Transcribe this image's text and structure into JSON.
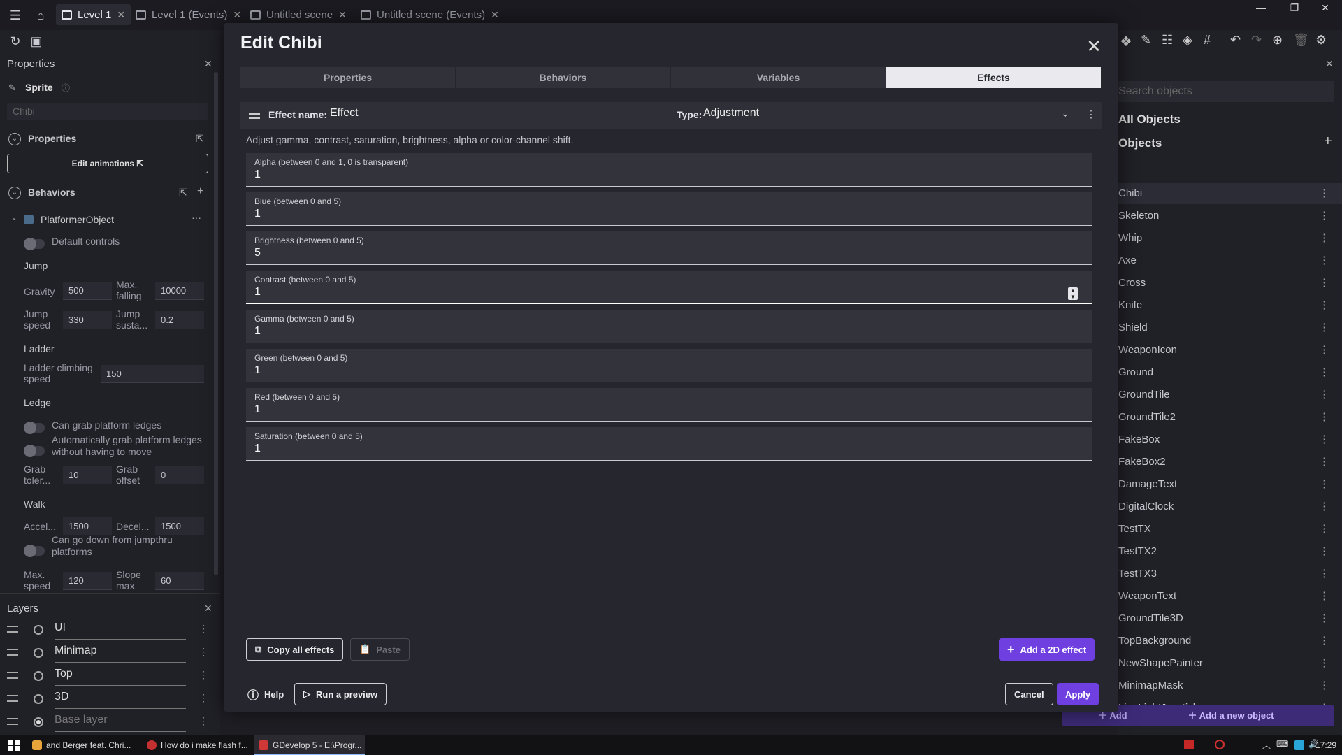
{
  "topbar": {
    "tabs": [
      {
        "label": "Level 1"
      },
      {
        "label": "Level 1 (Events)"
      },
      {
        "label": "Untitled scene"
      },
      {
        "label": "Untitled scene (Events)"
      }
    ],
    "clock": "17:29"
  },
  "left": {
    "properties_title": "Properties",
    "object_type": "Sprite",
    "object_name_placeholder": "Chibi",
    "properties_section": "Properties",
    "edit_animations": "Edit animations",
    "behaviors_section": "Behaviors",
    "behavior_name": "PlatformerObject",
    "default_controls": "Default controls",
    "jump_group": "Jump",
    "gravity_label": "Gravity",
    "gravity_value": "500",
    "max_falling_label": "Max. falling",
    "max_falling_value": "10000",
    "jump_speed_label": "Jump speed",
    "jump_speed_value": "330",
    "jump_sustain_label": "Jump susta...",
    "jump_sustain_value": "0.2",
    "ladder_group": "Ladder",
    "ladder_speed_label": "Ladder climbing speed",
    "ladder_speed_value": "150",
    "ledge_group": "Ledge",
    "can_grab_label": "Can grab platform ledges",
    "auto_grab_label": "Automatically grab platform ledges without having to move",
    "grab_tolerance_label": "Grab toler...",
    "grab_tolerance_value": "10",
    "grab_offset_label": "Grab offset",
    "grab_offset_value": "0",
    "walk_group": "Walk",
    "accel_label": "Accel...",
    "accel_value": "1500",
    "decel_label": "Decel...",
    "decel_value": "1500",
    "jumpthru_label": "Can go down from jumpthru platforms",
    "max_speed_label": "Max. speed",
    "max_speed_value": "120",
    "slope_label": "Slope max.",
    "slope_value": "60",
    "layers_title": "Layers",
    "layers": [
      {
        "name": "UI"
      },
      {
        "name": "Minimap"
      },
      {
        "name": "Top"
      },
      {
        "name": "3D"
      },
      {
        "name": "Base layer"
      }
    ]
  },
  "dialog": {
    "title": "Edit Chibi",
    "tabs": [
      "Properties",
      "Behaviors",
      "Variables",
      "Effects"
    ],
    "active_tab": "Effects",
    "effect_name_label": "Effect name:",
    "effect_name_value": "Effect",
    "type_label": "Type:",
    "type_value": "Adjustment",
    "description": "Adjust gamma, contrast, saturation, brightness, alpha or color-channel shift.",
    "fields": [
      {
        "label": "Alpha (between 0 and 1, 0 is transparent)",
        "value": "1"
      },
      {
        "label": "Blue (between 0 and 5)",
        "value": "1"
      },
      {
        "label": "Brightness (between 0 and 5)",
        "value": "5"
      },
      {
        "label": "Contrast (between 0 and 5)",
        "value": "1"
      },
      {
        "label": "Gamma (between 0 and 5)",
        "value": "1"
      },
      {
        "label": "Green (between 0 and 5)",
        "value": "1"
      },
      {
        "label": "Red (between 0 and 5)",
        "value": "1"
      },
      {
        "label": "Saturation (between 0 and 5)",
        "value": "1"
      }
    ],
    "copy_all": "Copy all effects",
    "paste": "Paste",
    "add_effect": "Add a 2D effect",
    "help": "Help",
    "run_preview": "Run a preview",
    "cancel": "Cancel",
    "apply": "Apply",
    "accent_color": "#6f3fe0"
  },
  "right": {
    "search_placeholder": "Search objects",
    "all_objects": "All Objects",
    "objects_header": "Objects",
    "objects": [
      "Chibi",
      "Skeleton",
      "Whip",
      "Axe",
      "Cross",
      "Knife",
      "Shield",
      "WeaponIcon",
      "Ground",
      "GroundTile",
      "GroundTile2",
      "FakeBox",
      "FakeBox2",
      "DamageText",
      "DigitalClock",
      "TestTX",
      "TestTX2",
      "TestTX3",
      "WeaponText",
      "GroundTile3D",
      "TopBackground",
      "NewShapePainter",
      "MinimapMask",
      "LineLightJoystick"
    ],
    "add_group": "Add a new group",
    "add_object": "Add a new object"
  },
  "taskbar": {
    "items": [
      {
        "label": "and Berger feat. Chri..."
      },
      {
        "label": "How do i make flash f..."
      },
      {
        "label": "GDevelop 5 - E:\\Progr..."
      }
    ]
  }
}
